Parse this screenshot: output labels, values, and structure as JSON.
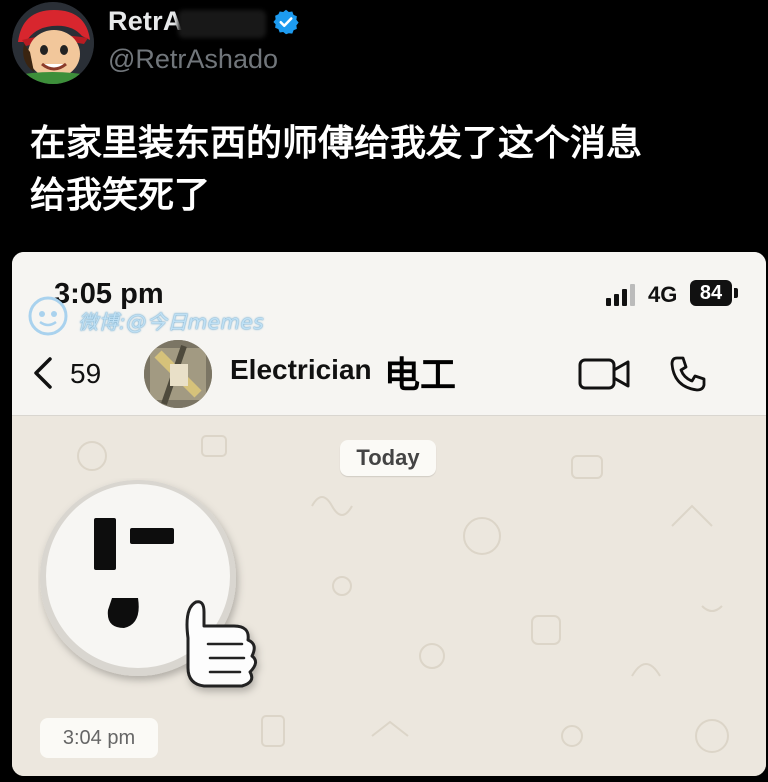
{
  "tweet": {
    "author_name": "RetrA",
    "handle": "@RetrAshado",
    "text_line1": "在家里装东西的师傅给我发了这个消息",
    "text_line2": "给我笑死了"
  },
  "phone": {
    "time": "3:05 pm",
    "network": "4G",
    "battery": "84"
  },
  "watermark": {
    "text": "微博:@今日memes"
  },
  "chat_header": {
    "back_count": "59",
    "contact_name": "Electrician",
    "contact_name_cn": "电工"
  },
  "chat": {
    "date_label": "Today",
    "message_time": "3:04 pm",
    "sticker": "outlet-face-thumbs-up"
  },
  "colors": {
    "background": "#000000",
    "verified_blue": "#1d9bf0",
    "chat_wallpaper": "#ece7de",
    "header_bg": "#f6f5f2"
  },
  "icons": [
    "verified-icon",
    "signal-icon",
    "battery-icon",
    "back-chevron-icon",
    "video-call-icon",
    "phone-call-icon",
    "weibo-logo-icon"
  ]
}
